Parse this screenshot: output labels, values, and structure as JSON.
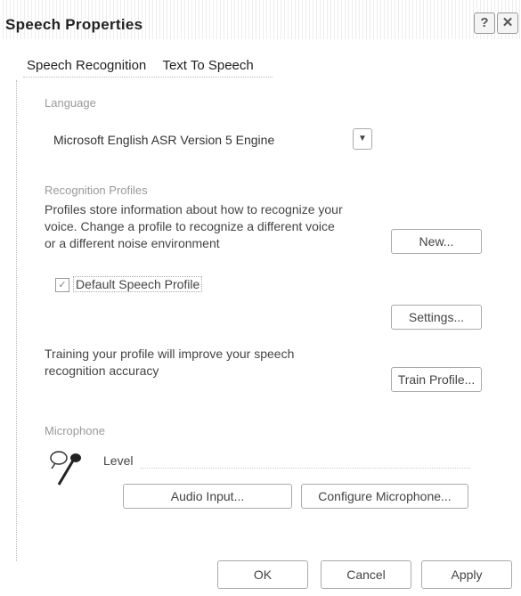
{
  "window": {
    "title": "Speech Properties",
    "help_label": "?",
    "close_label": "✕"
  },
  "tabs": [
    {
      "label": "Speech Recognition",
      "active": true
    },
    {
      "label": "Text To Speech",
      "active": false
    }
  ],
  "language": {
    "section_label": "Language",
    "selected": "Microsoft English ASR Version 5 Engine"
  },
  "profiles": {
    "section_label": "Recognition Profiles",
    "description_line1": "Profiles store information about how to recognize your",
    "description_line2": "voice.  Change a profile to recognize a different voice",
    "description_line3": "or a different noise environment",
    "new_label": "New...",
    "default_profile_label": "Default Speech Profile",
    "default_profile_checked": true,
    "settings_label": "Settings...",
    "training_line1": "Training your profile will improve your speech",
    "training_line2": "recognition accuracy",
    "train_label": "Train Profile..."
  },
  "microphone": {
    "section_label": "Microphone",
    "level_label": "Level",
    "audio_input_label": "Audio Input...",
    "configure_label": "Configure Microphone..."
  },
  "footer": {
    "ok_label": "OK",
    "cancel_label": "Cancel",
    "apply_label": "Apply"
  }
}
